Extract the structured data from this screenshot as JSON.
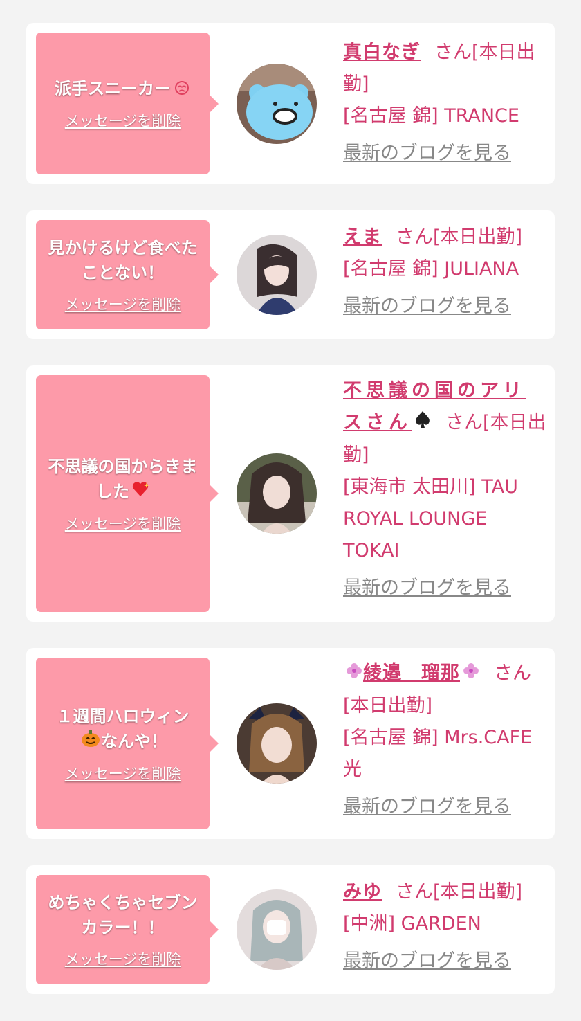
{
  "delete_label": "メッセージを削除",
  "blog_label": "最新のブログを見る",
  "colors": {
    "bubble": "#fd9aa9",
    "name": "#d13b6e",
    "blog_link": "#888888",
    "background": "#f3f3f3"
  },
  "cards": [
    {
      "message": "派手スニーカー",
      "emoji": "tearful-face-icon",
      "name": "真白なぎ",
      "status": "さん[本日出勤]",
      "shop": "[名古屋 錦] TRANCE"
    },
    {
      "message": "見かけるけど食べたことない！",
      "name": "えま",
      "status": "さん[本日出勤]",
      "shop": "[名古屋 錦] JULIANA"
    },
    {
      "message": "不思議の国からきました",
      "emoji": "sparkling-heart-icon",
      "name": "不思議の国のアリスさん",
      "name_emoji": "spade-icon",
      "status": "さん[本日出勤]",
      "shop": "[東海市 太田川] TAU ROYAL LOUNGE TOKAI"
    },
    {
      "message": "１週間ハロウィン",
      "emoji": "pumpkin-icon",
      "message2": "なんや！",
      "name": "綾邉　瑠那",
      "name_emoji": "flower-icon",
      "status": "さん[本日出勤]",
      "shop": "[名古屋 錦] Mrs.CAFE 光"
    },
    {
      "message": "めちゃくちゃセブンカラー！！",
      "name": "みゆ",
      "status": "さん[本日出勤]",
      "shop": "[中洲] GARDEN"
    }
  ]
}
